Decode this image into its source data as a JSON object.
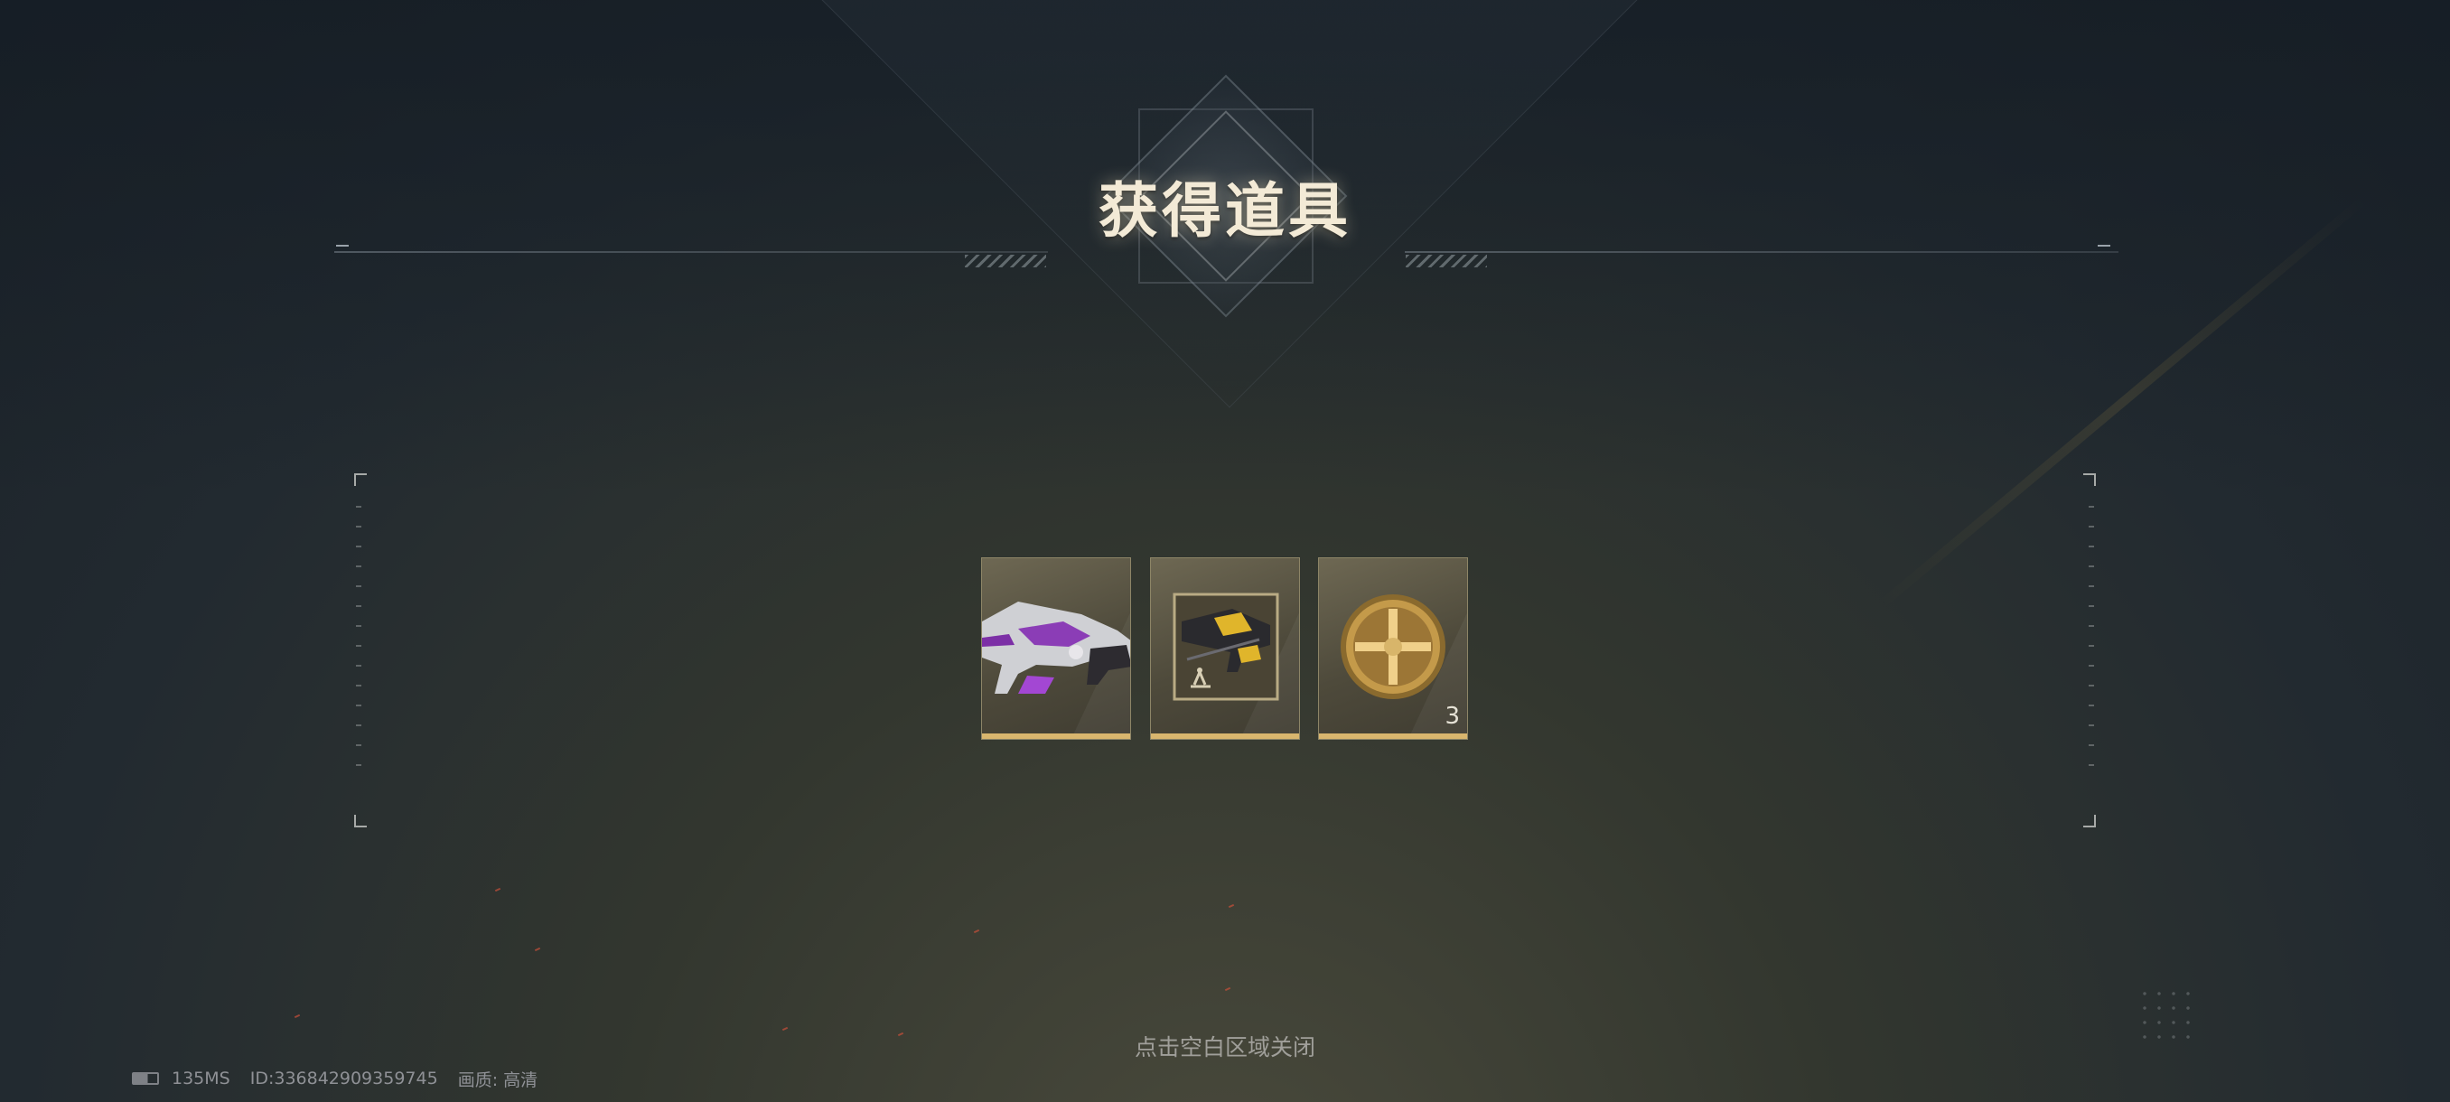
{
  "header": {
    "title": "获得道具"
  },
  "rewards": [
    {
      "name": "purple-rifle-skin",
      "icon": "rifle-skin-icon",
      "count": ""
    },
    {
      "name": "blueprint-rifle",
      "icon": "blueprint-rifle-icon",
      "count": ""
    },
    {
      "name": "gold-medal",
      "icon": "gold-cross-medal-icon",
      "count": "3"
    }
  ],
  "footer": {
    "close_hint": "点击空白区域关闭",
    "ping": "135MS",
    "player_id": "ID:336842909359745",
    "quality_label": "画质:",
    "quality_value": "高清"
  },
  "colors": {
    "accent": "#d9b66e",
    "title": "#f3ead6",
    "card_bg": "#5a5545"
  }
}
